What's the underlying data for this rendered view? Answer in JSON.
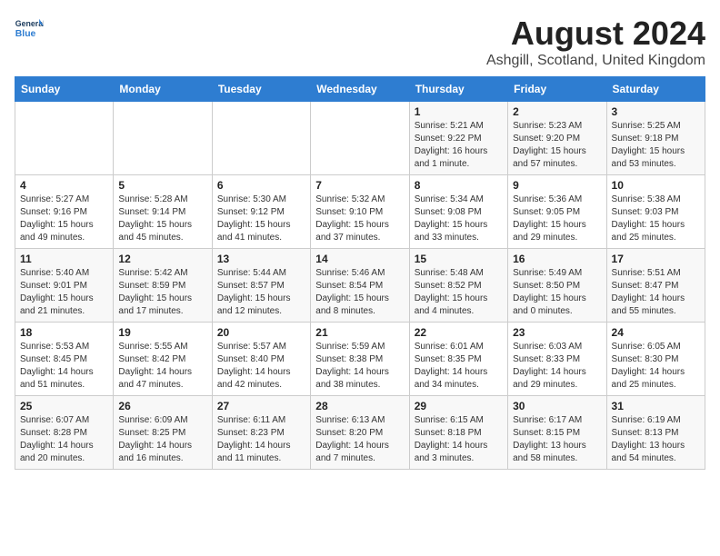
{
  "header": {
    "logo_line1": "General",
    "logo_line2": "Blue",
    "main_title": "August 2024",
    "subtitle": "Ashgill, Scotland, United Kingdom"
  },
  "calendar": {
    "days_of_week": [
      "Sunday",
      "Monday",
      "Tuesday",
      "Wednesday",
      "Thursday",
      "Friday",
      "Saturday"
    ],
    "weeks": [
      [
        {
          "day": "",
          "info": ""
        },
        {
          "day": "",
          "info": ""
        },
        {
          "day": "",
          "info": ""
        },
        {
          "day": "",
          "info": ""
        },
        {
          "day": "1",
          "info": "Sunrise: 5:21 AM\nSunset: 9:22 PM\nDaylight: 16 hours\nand 1 minute."
        },
        {
          "day": "2",
          "info": "Sunrise: 5:23 AM\nSunset: 9:20 PM\nDaylight: 15 hours\nand 57 minutes."
        },
        {
          "day": "3",
          "info": "Sunrise: 5:25 AM\nSunset: 9:18 PM\nDaylight: 15 hours\nand 53 minutes."
        }
      ],
      [
        {
          "day": "4",
          "info": "Sunrise: 5:27 AM\nSunset: 9:16 PM\nDaylight: 15 hours\nand 49 minutes."
        },
        {
          "day": "5",
          "info": "Sunrise: 5:28 AM\nSunset: 9:14 PM\nDaylight: 15 hours\nand 45 minutes."
        },
        {
          "day": "6",
          "info": "Sunrise: 5:30 AM\nSunset: 9:12 PM\nDaylight: 15 hours\nand 41 minutes."
        },
        {
          "day": "7",
          "info": "Sunrise: 5:32 AM\nSunset: 9:10 PM\nDaylight: 15 hours\nand 37 minutes."
        },
        {
          "day": "8",
          "info": "Sunrise: 5:34 AM\nSunset: 9:08 PM\nDaylight: 15 hours\nand 33 minutes."
        },
        {
          "day": "9",
          "info": "Sunrise: 5:36 AM\nSunset: 9:05 PM\nDaylight: 15 hours\nand 29 minutes."
        },
        {
          "day": "10",
          "info": "Sunrise: 5:38 AM\nSunset: 9:03 PM\nDaylight: 15 hours\nand 25 minutes."
        }
      ],
      [
        {
          "day": "11",
          "info": "Sunrise: 5:40 AM\nSunset: 9:01 PM\nDaylight: 15 hours\nand 21 minutes."
        },
        {
          "day": "12",
          "info": "Sunrise: 5:42 AM\nSunset: 8:59 PM\nDaylight: 15 hours\nand 17 minutes."
        },
        {
          "day": "13",
          "info": "Sunrise: 5:44 AM\nSunset: 8:57 PM\nDaylight: 15 hours\nand 12 minutes."
        },
        {
          "day": "14",
          "info": "Sunrise: 5:46 AM\nSunset: 8:54 PM\nDaylight: 15 hours\nand 8 minutes."
        },
        {
          "day": "15",
          "info": "Sunrise: 5:48 AM\nSunset: 8:52 PM\nDaylight: 15 hours\nand 4 minutes."
        },
        {
          "day": "16",
          "info": "Sunrise: 5:49 AM\nSunset: 8:50 PM\nDaylight: 15 hours\nand 0 minutes."
        },
        {
          "day": "17",
          "info": "Sunrise: 5:51 AM\nSunset: 8:47 PM\nDaylight: 14 hours\nand 55 minutes."
        }
      ],
      [
        {
          "day": "18",
          "info": "Sunrise: 5:53 AM\nSunset: 8:45 PM\nDaylight: 14 hours\nand 51 minutes."
        },
        {
          "day": "19",
          "info": "Sunrise: 5:55 AM\nSunset: 8:42 PM\nDaylight: 14 hours\nand 47 minutes."
        },
        {
          "day": "20",
          "info": "Sunrise: 5:57 AM\nSunset: 8:40 PM\nDaylight: 14 hours\nand 42 minutes."
        },
        {
          "day": "21",
          "info": "Sunrise: 5:59 AM\nSunset: 8:38 PM\nDaylight: 14 hours\nand 38 minutes."
        },
        {
          "day": "22",
          "info": "Sunrise: 6:01 AM\nSunset: 8:35 PM\nDaylight: 14 hours\nand 34 minutes."
        },
        {
          "day": "23",
          "info": "Sunrise: 6:03 AM\nSunset: 8:33 PM\nDaylight: 14 hours\nand 29 minutes."
        },
        {
          "day": "24",
          "info": "Sunrise: 6:05 AM\nSunset: 8:30 PM\nDaylight: 14 hours\nand 25 minutes."
        }
      ],
      [
        {
          "day": "25",
          "info": "Sunrise: 6:07 AM\nSunset: 8:28 PM\nDaylight: 14 hours\nand 20 minutes."
        },
        {
          "day": "26",
          "info": "Sunrise: 6:09 AM\nSunset: 8:25 PM\nDaylight: 14 hours\nand 16 minutes."
        },
        {
          "day": "27",
          "info": "Sunrise: 6:11 AM\nSunset: 8:23 PM\nDaylight: 14 hours\nand 11 minutes."
        },
        {
          "day": "28",
          "info": "Sunrise: 6:13 AM\nSunset: 8:20 PM\nDaylight: 14 hours\nand 7 minutes."
        },
        {
          "day": "29",
          "info": "Sunrise: 6:15 AM\nSunset: 8:18 PM\nDaylight: 14 hours\nand 3 minutes."
        },
        {
          "day": "30",
          "info": "Sunrise: 6:17 AM\nSunset: 8:15 PM\nDaylight: 13 hours\nand 58 minutes."
        },
        {
          "day": "31",
          "info": "Sunrise: 6:19 AM\nSunset: 8:13 PM\nDaylight: 13 hours\nand 54 minutes."
        }
      ]
    ]
  }
}
